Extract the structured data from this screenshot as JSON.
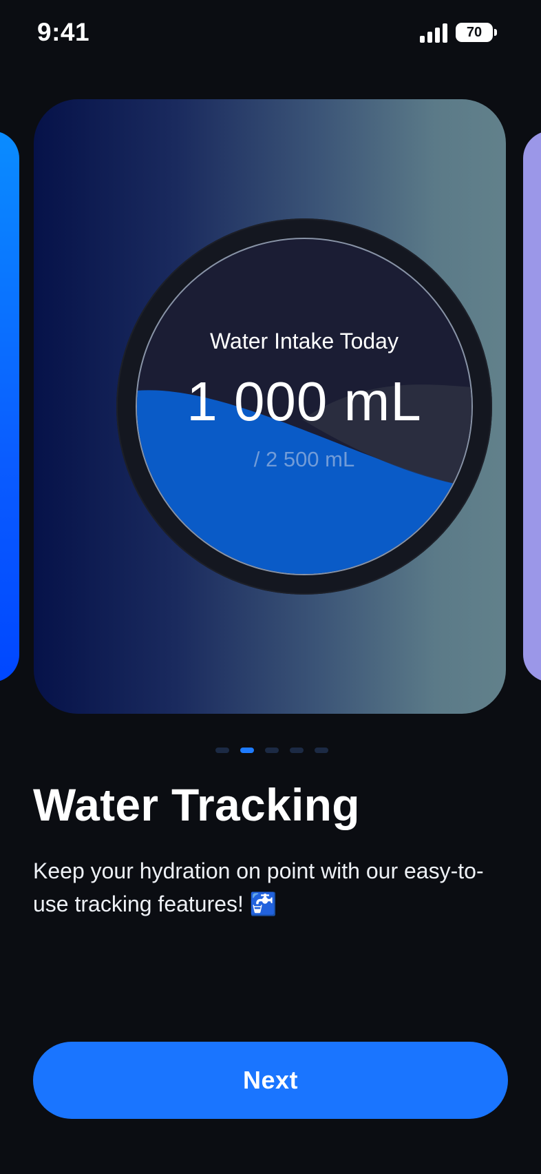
{
  "status_bar": {
    "time": "9:41",
    "battery": "70",
    "icons": [
      "signal-icon",
      "battery-icon"
    ]
  },
  "card": {
    "title": "Water Intake Today",
    "value": "1 000 mL",
    "goal": "/ 2 500 mL",
    "fill_fraction": 0.4,
    "colors": {
      "water": "#0a5fcf",
      "gauge_bg": "#1b1d34"
    }
  },
  "pager": {
    "count": 5,
    "active_index": 1
  },
  "onboarding": {
    "title": "Water Tracking",
    "description": "Keep your hydration on point with our easy-to-use tracking features! 🚰"
  },
  "actions": {
    "next_label": "Next"
  },
  "colors": {
    "accent": "#1a75ff",
    "background": "#0b0d12"
  }
}
